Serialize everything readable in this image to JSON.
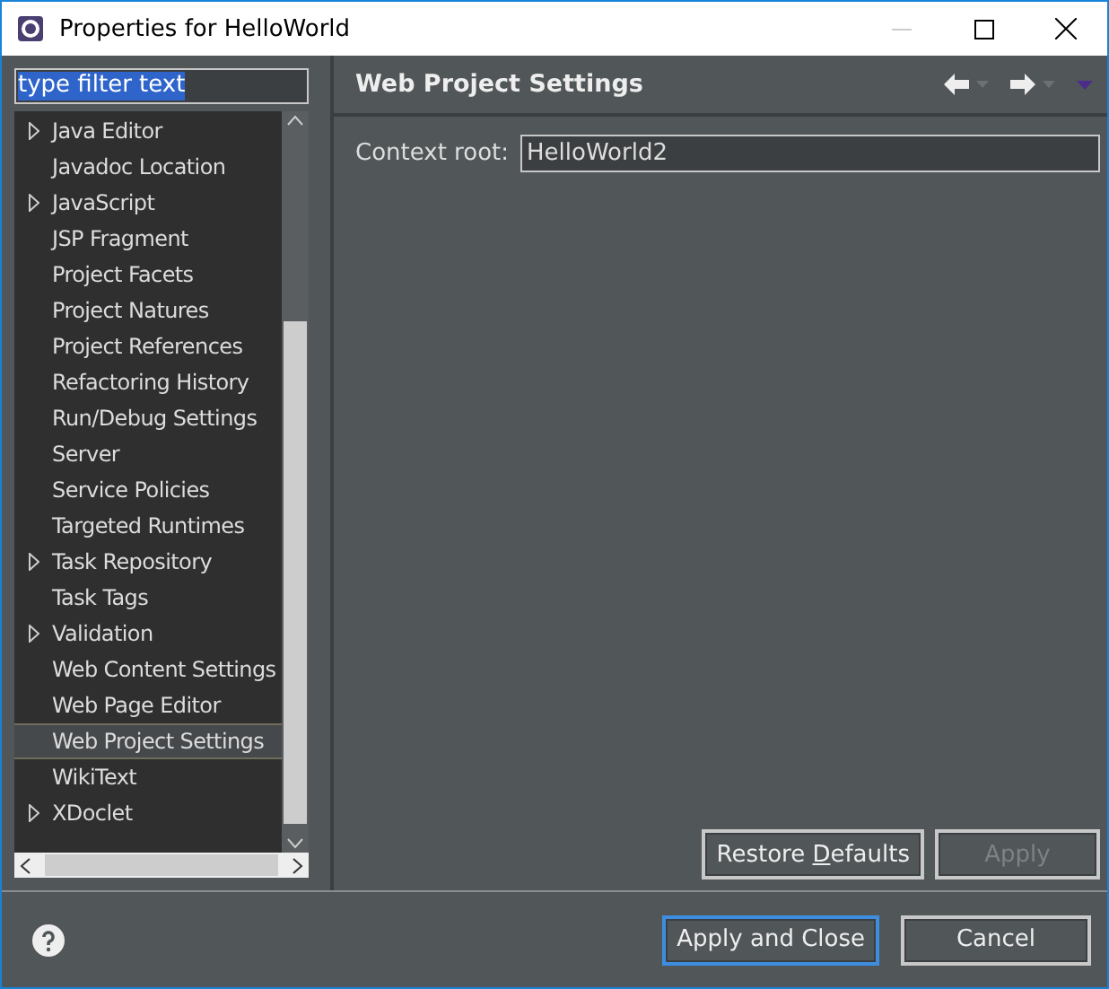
{
  "window": {
    "title": "Properties for HelloWorld"
  },
  "filter": {
    "value": "type filter text"
  },
  "tree": [
    {
      "label": "Java Editor",
      "expandable": true,
      "selected": false
    },
    {
      "label": "Javadoc Location",
      "expandable": false,
      "selected": false
    },
    {
      "label": "JavaScript",
      "expandable": true,
      "selected": false
    },
    {
      "label": "JSP Fragment",
      "expandable": false,
      "selected": false
    },
    {
      "label": "Project Facets",
      "expandable": false,
      "selected": false
    },
    {
      "label": "Project Natures",
      "expandable": false,
      "selected": false
    },
    {
      "label": "Project References",
      "expandable": false,
      "selected": false
    },
    {
      "label": "Refactoring History",
      "expandable": false,
      "selected": false
    },
    {
      "label": "Run/Debug Settings",
      "expandable": false,
      "selected": false
    },
    {
      "label": "Server",
      "expandable": false,
      "selected": false
    },
    {
      "label": "Service Policies",
      "expandable": false,
      "selected": false
    },
    {
      "label": "Targeted Runtimes",
      "expandable": false,
      "selected": false
    },
    {
      "label": "Task Repository",
      "expandable": true,
      "selected": false
    },
    {
      "label": "Task Tags",
      "expandable": false,
      "selected": false
    },
    {
      "label": "Validation",
      "expandable": true,
      "selected": false
    },
    {
      "label": "Web Content Settings",
      "expandable": false,
      "selected": false
    },
    {
      "label": "Web Page Editor",
      "expandable": false,
      "selected": false
    },
    {
      "label": "Web Project Settings",
      "expandable": false,
      "selected": true
    },
    {
      "label": "WikiText",
      "expandable": false,
      "selected": false
    },
    {
      "label": "XDoclet",
      "expandable": true,
      "selected": false
    }
  ],
  "page": {
    "title": "Web Project Settings",
    "field_label": "Context root:",
    "field_value": "HelloWorld2"
  },
  "page_buttons": [
    {
      "text_before": "Restore ",
      "mnemonic": "D",
      "text_after": "efaults",
      "disabled": false
    },
    {
      "text_before": "Apply",
      "disabled": true
    }
  ],
  "dialog_buttons": [
    {
      "label": "Apply and Close",
      "default": true
    },
    {
      "label": "Cancel",
      "default": false
    }
  ]
}
